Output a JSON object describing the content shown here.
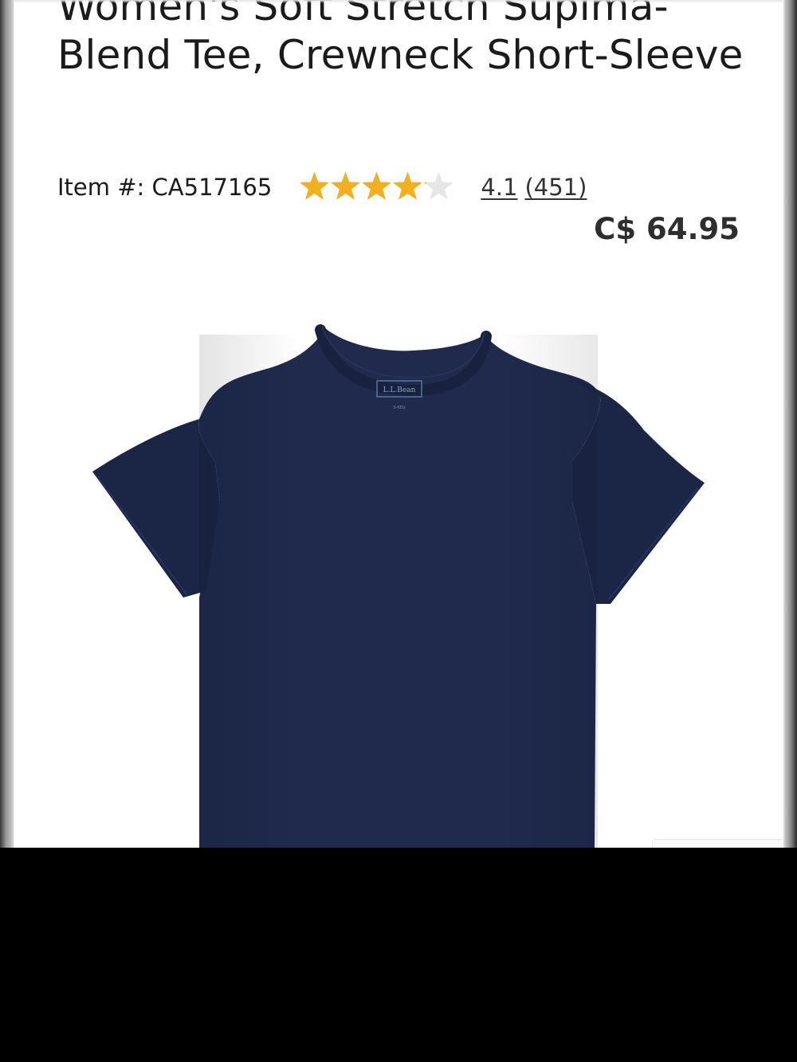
{
  "product": {
    "title": "Women's Soft Stretch Supima-Blend Tee, Crewneck Short-Sleeve",
    "item_label": "Item #:",
    "item_number": "CA517165",
    "rating": {
      "value": "4.1",
      "count": "(451)",
      "stars_filled": 4.1,
      "stars_total": 5,
      "star_color": "#f2b01e",
      "star_empty_color": "#e6e6e6"
    },
    "price": "C$ 64.95",
    "image": {
      "garment_color": "#1f2a4d",
      "label_brand": "L.L.Bean",
      "label_size": "S-REG"
    }
  }
}
